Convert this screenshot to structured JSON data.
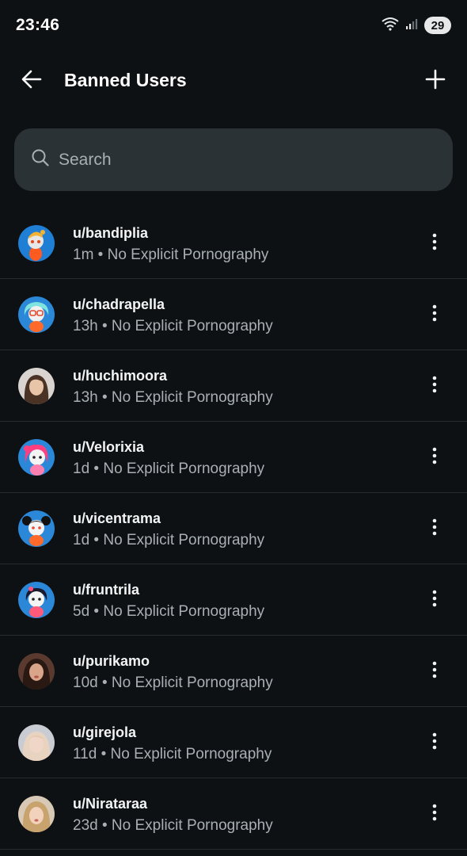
{
  "status_bar": {
    "time": "23:46",
    "battery": "29",
    "icons": [
      "wifi-icon",
      "signal-icon"
    ]
  },
  "header": {
    "title": "Banned Users",
    "back_icon": "arrow-left-icon",
    "add_icon": "plus-icon"
  },
  "search": {
    "placeholder": "Search",
    "value": "",
    "icon": "search-icon"
  },
  "colors": {
    "background": "#0e1113",
    "search_bg": "#2a3236",
    "secondary_text": "#a8b0b4",
    "divider": "#272c2f"
  },
  "banned_users": [
    {
      "username": "u/bandiplia",
      "meta": "1m • No Explicit Pornography",
      "avatar": "snoo-avatar"
    },
    {
      "username": "u/chadrapella",
      "meta": "13h • No Explicit Pornography",
      "avatar": "snoo-avatar"
    },
    {
      "username": "u/huchimoora",
      "meta": "13h • No Explicit Pornography",
      "avatar": "photo-avatar"
    },
    {
      "username": "u/Velorixia",
      "meta": "1d • No Explicit Pornography",
      "avatar": "snoo-avatar"
    },
    {
      "username": "u/vicentrama",
      "meta": "1d • No Explicit Pornography",
      "avatar": "snoo-avatar"
    },
    {
      "username": "u/fruntrila",
      "meta": "5d • No Explicit Pornography",
      "avatar": "snoo-avatar"
    },
    {
      "username": "u/purikamo",
      "meta": "10d • No Explicit Pornography",
      "avatar": "photo-avatar"
    },
    {
      "username": "u/girejola",
      "meta": "11d • No Explicit Pornography",
      "avatar": "photo-avatar"
    },
    {
      "username": "u/Nirataraa",
      "meta": "23d • No Explicit Pornography",
      "avatar": "photo-avatar"
    }
  ]
}
